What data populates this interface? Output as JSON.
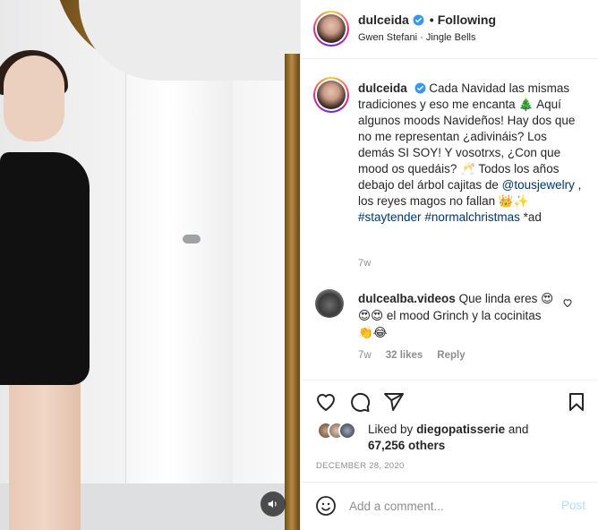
{
  "header": {
    "username": "dulceida",
    "follow_status": "Following",
    "dot": "•",
    "audio": "Gwen Stefani · Jingle Bells"
  },
  "caption": {
    "username": "dulceida",
    "text_part1": "Cada Navidad las mismas tradiciones y eso me encanta 🎄 Aquí algunos moods Navideños! Hay dos que no me representan ¿adivináis? Los demás SI SOY! Y vosotrxs, ¿Con que mood os quedáis? 🥂 Todos los años debajo del árbol cajitas de",
    "mention": "@tousjewelry",
    "text_part2": ", los reyes magos no fallan 👑✨",
    "hashtag1": "#staytender",
    "hashtag2": "#normalchristmas",
    "text_end": "*ad",
    "time": "7w"
  },
  "comment": {
    "username": "dulcealba.videos",
    "text": "Que linda eres 😍😍😍 el mood Grinch y la cocinitas 👏😂",
    "time": "7w",
    "likes": "32 likes",
    "reply": "Reply"
  },
  "likes": {
    "prefix": "Liked by",
    "user": "diegopatisserie",
    "and": "and",
    "others": "67,256 others"
  },
  "date": "DECEMBER 28, 2020",
  "add_comment": {
    "placeholder": "Add a comment...",
    "post": "Post"
  },
  "colors": {
    "verified": "#3897f0",
    "link": "#00376b",
    "muted": "#8e8e8e",
    "post_disabled": "#b2dffc"
  }
}
